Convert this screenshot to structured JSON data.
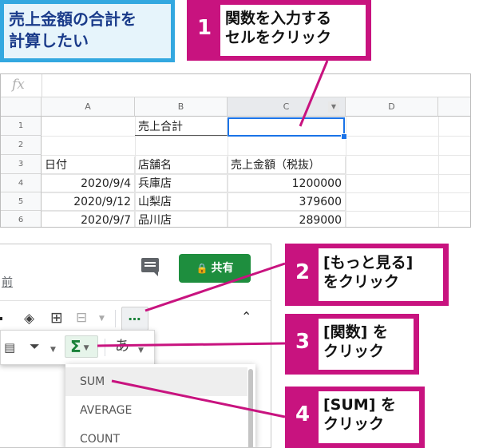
{
  "title": {
    "line1": "売上金額の合計を",
    "line2": "計算したい"
  },
  "callouts": [
    {
      "num": "1",
      "text": "関数を入力する\nセルをクリック"
    },
    {
      "num": "2",
      "text": "[もっと見る]\nをクリック"
    },
    {
      "num": "3",
      "text": "[関数] を\nクリック"
    },
    {
      "num": "4",
      "text": "[SUM] を\nクリック"
    }
  ],
  "sheet": {
    "fx_label": "fx",
    "columns": [
      "A",
      "B",
      "C",
      "D"
    ],
    "rows": [
      "1",
      "2",
      "3",
      "4",
      "5",
      "6"
    ],
    "b1": "売上合計",
    "headers": {
      "a3": "日付",
      "b3": "店舗名",
      "c3": "売上金額（税抜）"
    },
    "data": [
      {
        "date": "2020/9/4",
        "store": "兵庫店",
        "amount": "1200000"
      },
      {
        "date": "2020/9/12",
        "store": "山梨店",
        "amount": "379600"
      },
      {
        "date": "2020/9/7",
        "store": "品川店",
        "amount": "289000"
      }
    ]
  },
  "panel": {
    "name_fragment": "前",
    "share_label": "共有",
    "more_label": "…",
    "function_label": "Σ",
    "input_tool_label": "あ",
    "menu": [
      "SUM",
      "AVERAGE",
      "COUNT"
    ]
  },
  "colors": {
    "accent_magenta": "#c8137f",
    "title_blue": "#33a8e0",
    "share_green": "#1e8e3e",
    "select_blue": "#1a73e8"
  },
  "icons": {
    "comment": "comment-icon",
    "lock": "lock-icon",
    "paint": "fill-color-icon",
    "borders": "borders-icon",
    "merge": "merge-cells-icon",
    "collapse": "chevron-up-icon",
    "chart": "chart-icon",
    "filter": "filter-icon",
    "sigma": "sigma-icon"
  }
}
